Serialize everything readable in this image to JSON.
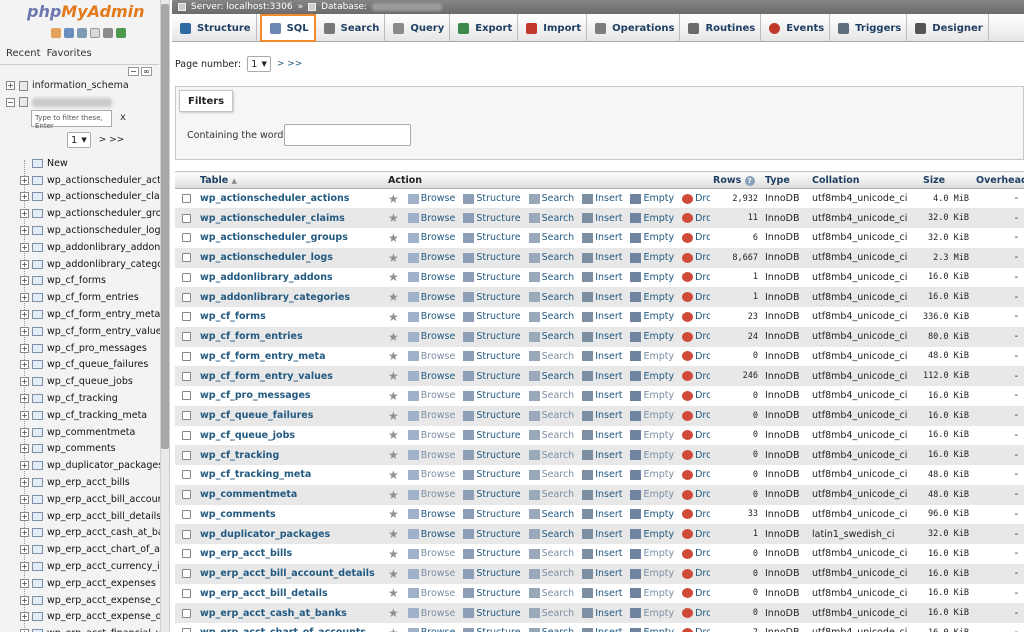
{
  "app": {
    "logo_main": "php",
    "logo_brand": "MyAdmin"
  },
  "nav": {
    "tabs": [
      "Recent",
      "Favorites"
    ],
    "databases": [
      "information_schema"
    ],
    "filter_placeholder": "Type to filter these, Enter",
    "filter_clear": "x",
    "page_select": "1",
    "page_next": "> >>",
    "new_label": "New",
    "tables": [
      "wp_actionscheduler_actions",
      "wp_actionscheduler_claims",
      "wp_actionscheduler_groups",
      "wp_actionscheduler_logs",
      "wp_addonlibrary_addons",
      "wp_addonlibrary_categories",
      "wp_cf_forms",
      "wp_cf_form_entries",
      "wp_cf_form_entry_meta",
      "wp_cf_form_entry_values",
      "wp_cf_pro_messages",
      "wp_cf_queue_failures",
      "wp_cf_queue_jobs",
      "wp_cf_tracking",
      "wp_cf_tracking_meta",
      "wp_commentmeta",
      "wp_comments",
      "wp_duplicator_packages",
      "wp_erp_acct_bills",
      "wp_erp_acct_bill_account",
      "wp_erp_acct_bill_details",
      "wp_erp_acct_cash_at_ban",
      "wp_erp_acct_chart_of_acc",
      "wp_erp_acct_currency_info",
      "wp_erp_acct_expenses",
      "wp_erp_acct_expense_che",
      "wp_erp_acct_expense_det",
      "wp_erp_acct_financial_yea"
    ]
  },
  "breadcrumb": {
    "server": "Server: localhost:3306",
    "sep": "»",
    "database": "Database:"
  },
  "menu": {
    "tabs": [
      {
        "label": "Structure",
        "icon": "structure-icon",
        "color": "#2f6aa3"
      },
      {
        "label": "SQL",
        "icon": "sql-icon",
        "color": "#6b87b4"
      },
      {
        "label": "Search",
        "icon": "search-icon",
        "color": "#777777"
      },
      {
        "label": "Query",
        "icon": "query-icon",
        "color": "#8a8a8a"
      },
      {
        "label": "Export",
        "icon": "export-icon",
        "color": "#3d8a4a"
      },
      {
        "label": "Import",
        "icon": "import-icon",
        "color": "#c0392b"
      },
      {
        "label": "Operations",
        "icon": "wrench-icon",
        "color": "#7d7d7d"
      },
      {
        "label": "Routines",
        "icon": "routines-icon",
        "color": "#6a6a6a"
      },
      {
        "label": "Events",
        "icon": "clock-icon",
        "color": "#c0392b"
      },
      {
        "label": "Triggers",
        "icon": "triggers-icon",
        "color": "#5d6d7e"
      },
      {
        "label": "Designer",
        "icon": "designer-icon",
        "color": "#555555"
      }
    ],
    "active": "SQL"
  },
  "pagination": {
    "label": "Page number:",
    "value": "1",
    "next": "> >>"
  },
  "filters": {
    "legend": "Filters",
    "label": "Containing the word:"
  },
  "table": {
    "headers": {
      "table": "Table",
      "action": "Action",
      "rows": "Rows",
      "type": "Type",
      "collation": "Collation",
      "size": "Size",
      "overhead": "Overhead"
    },
    "actions": [
      "Browse",
      "Structure",
      "Search",
      "Insert",
      "Empty",
      "Drop"
    ],
    "rows": [
      {
        "name": "wp_actionscheduler_actions",
        "rows": "2,932",
        "type": "InnoDB",
        "collation": "utf8mb4_unicode_ci",
        "size": "4.0 MiB",
        "overhead": "-"
      },
      {
        "name": "wp_actionscheduler_claims",
        "rows": "11",
        "type": "InnoDB",
        "collation": "utf8mb4_unicode_ci",
        "size": "32.0 KiB",
        "overhead": "-"
      },
      {
        "name": "wp_actionscheduler_groups",
        "rows": "6",
        "type": "InnoDB",
        "collation": "utf8mb4_unicode_ci",
        "size": "32.0 KiB",
        "overhead": "-"
      },
      {
        "name": "wp_actionscheduler_logs",
        "rows": "8,667",
        "type": "InnoDB",
        "collation": "utf8mb4_unicode_ci",
        "size": "2.3 MiB",
        "overhead": "-"
      },
      {
        "name": "wp_addonlibrary_addons",
        "rows": "1",
        "type": "InnoDB",
        "collation": "utf8mb4_unicode_ci",
        "size": "16.0 KiB",
        "overhead": "-"
      },
      {
        "name": "wp_addonlibrary_categories",
        "rows": "1",
        "type": "InnoDB",
        "collation": "utf8mb4_unicode_ci",
        "size": "16.0 KiB",
        "overhead": "-"
      },
      {
        "name": "wp_cf_forms",
        "rows": "23",
        "type": "InnoDB",
        "collation": "utf8mb4_unicode_ci",
        "size": "336.0 KiB",
        "overhead": "-"
      },
      {
        "name": "wp_cf_form_entries",
        "rows": "24",
        "type": "InnoDB",
        "collation": "utf8mb4_unicode_ci",
        "size": "80.0 KiB",
        "overhead": "-"
      },
      {
        "name": "wp_cf_form_entry_meta",
        "rows": "0",
        "type": "InnoDB",
        "collation": "utf8mb4_unicode_ci",
        "size": "48.0 KiB",
        "overhead": "-"
      },
      {
        "name": "wp_cf_form_entry_values",
        "rows": "246",
        "type": "InnoDB",
        "collation": "utf8mb4_unicode_ci",
        "size": "112.0 KiB",
        "overhead": "-"
      },
      {
        "name": "wp_cf_pro_messages",
        "rows": "0",
        "type": "InnoDB",
        "collation": "utf8mb4_unicode_ci",
        "size": "16.0 KiB",
        "overhead": "-"
      },
      {
        "name": "wp_cf_queue_failures",
        "rows": "0",
        "type": "InnoDB",
        "collation": "utf8mb4_unicode_ci",
        "size": "16.0 KiB",
        "overhead": "-"
      },
      {
        "name": "wp_cf_queue_jobs",
        "rows": "0",
        "type": "InnoDB",
        "collation": "utf8mb4_unicode_ci",
        "size": "16.0 KiB",
        "overhead": "-"
      },
      {
        "name": "wp_cf_tracking",
        "rows": "0",
        "type": "InnoDB",
        "collation": "utf8mb4_unicode_ci",
        "size": "16.0 KiB",
        "overhead": "-"
      },
      {
        "name": "wp_cf_tracking_meta",
        "rows": "0",
        "type": "InnoDB",
        "collation": "utf8mb4_unicode_ci",
        "size": "48.0 KiB",
        "overhead": "-"
      },
      {
        "name": "wp_commentmeta",
        "rows": "0",
        "type": "InnoDB",
        "collation": "utf8mb4_unicode_ci",
        "size": "48.0 KiB",
        "overhead": "-"
      },
      {
        "name": "wp_comments",
        "rows": "33",
        "type": "InnoDB",
        "collation": "utf8mb4_unicode_ci",
        "size": "96.0 KiB",
        "overhead": "-"
      },
      {
        "name": "wp_duplicator_packages",
        "rows": "1",
        "type": "InnoDB",
        "collation": "latin1_swedish_ci",
        "size": "32.0 KiB",
        "overhead": "-"
      },
      {
        "name": "wp_erp_acct_bills",
        "rows": "0",
        "type": "InnoDB",
        "collation": "utf8mb4_unicode_ci",
        "size": "16.0 KiB",
        "overhead": "-"
      },
      {
        "name": "wp_erp_acct_bill_account_details",
        "rows": "0",
        "type": "InnoDB",
        "collation": "utf8mb4_unicode_ci",
        "size": "16.0 KiB",
        "overhead": "-"
      },
      {
        "name": "wp_erp_acct_bill_details",
        "rows": "0",
        "type": "InnoDB",
        "collation": "utf8mb4_unicode_ci",
        "size": "16.0 KiB",
        "overhead": "-"
      },
      {
        "name": "wp_erp_acct_cash_at_banks",
        "rows": "0",
        "type": "InnoDB",
        "collation": "utf8mb4_unicode_ci",
        "size": "16.0 KiB",
        "overhead": "-"
      },
      {
        "name": "wp_erp_acct_chart_of_accounts",
        "rows": "7",
        "type": "InnoDB",
        "collation": "utf8mb4_unicode_ci",
        "size": "16.0 KiB",
        "overhead": "-"
      }
    ]
  }
}
